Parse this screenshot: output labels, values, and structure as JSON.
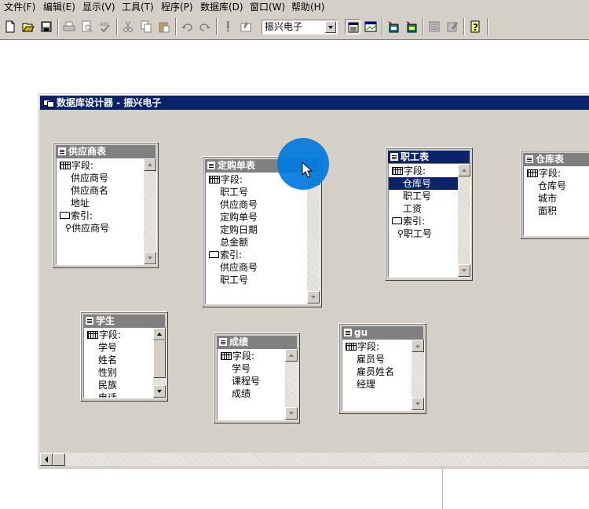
{
  "menu": [
    {
      "label": "文件(F)"
    },
    {
      "label": "编辑(E)"
    },
    {
      "label": "显示(V)"
    },
    {
      "label": "工具(T)"
    },
    {
      "label": "程序(P)"
    },
    {
      "label": "数据库(D)"
    },
    {
      "label": "窗口(W)"
    },
    {
      "label": "帮助(H)"
    }
  ],
  "toolbar": {
    "database_selected": "振兴电子",
    "icons": [
      "new-icon",
      "open-icon",
      "save-icon",
      "print-icon",
      "print-preview-icon",
      "spell-check-icon",
      "cut-icon",
      "copy-icon",
      "paste-icon",
      "undo-icon",
      "redo-icon",
      "run-icon",
      "modify-icon",
      "database-icon",
      "window-list-icon",
      "table-icon",
      "table2-icon",
      "form-icon",
      "edit-form-icon",
      "help-icon"
    ]
  },
  "designer": {
    "title": "数据库设计器 - 振兴电子",
    "tables": [
      {
        "name": "供应商表",
        "rows": [
          {
            "text": "字段:",
            "icon": "field"
          },
          {
            "text": "供应商号"
          },
          {
            "text": "供应商名"
          },
          {
            "text": "地址"
          },
          {
            "text": "索引:",
            "icon": "index"
          },
          {
            "text": "供应商号",
            "icon": "key"
          }
        ]
      },
      {
        "name": "定购单表",
        "rows": [
          {
            "text": "字段:",
            "icon": "field"
          },
          {
            "text": "职工号"
          },
          {
            "text": "供应商号"
          },
          {
            "text": "定购单号"
          },
          {
            "text": "定购日期"
          },
          {
            "text": "总金额"
          },
          {
            "text": "索引:",
            "icon": "index"
          },
          {
            "text": "供应商号"
          },
          {
            "text": "职工号"
          }
        ]
      },
      {
        "name": "职工表",
        "rows": [
          {
            "text": "字段:",
            "icon": "field"
          },
          {
            "text": "仓库号",
            "selected": true
          },
          {
            "text": "职工号"
          },
          {
            "text": "工资"
          },
          {
            "text": "索引:",
            "icon": "index"
          },
          {
            "text": "职工号",
            "icon": "key"
          }
        ]
      },
      {
        "name": "仓库表",
        "rows": [
          {
            "text": "字段:",
            "icon": "field"
          },
          {
            "text": "仓库号"
          },
          {
            "text": "城市"
          },
          {
            "text": "面积"
          }
        ]
      },
      {
        "name": "学生",
        "rows": [
          {
            "text": "字段:",
            "icon": "field"
          },
          {
            "text": "学号"
          },
          {
            "text": "姓名"
          },
          {
            "text": "性别"
          },
          {
            "text": "民族"
          },
          {
            "text": "电话"
          }
        ]
      },
      {
        "name": "成绩",
        "rows": [
          {
            "text": "字段:",
            "icon": "field"
          },
          {
            "text": "学号"
          },
          {
            "text": "课程号"
          },
          {
            "text": "成绩"
          }
        ]
      },
      {
        "name": "gu",
        "rows": [
          {
            "text": "字段:",
            "icon": "field"
          },
          {
            "text": "雇员号"
          },
          {
            "text": "雇员姓名"
          },
          {
            "text": "经理"
          }
        ]
      }
    ]
  },
  "colors": {
    "face": "#d4d0c8",
    "title_active": "#0a246a",
    "title_inactive": "#808080",
    "click_highlight": "#007ae0"
  }
}
